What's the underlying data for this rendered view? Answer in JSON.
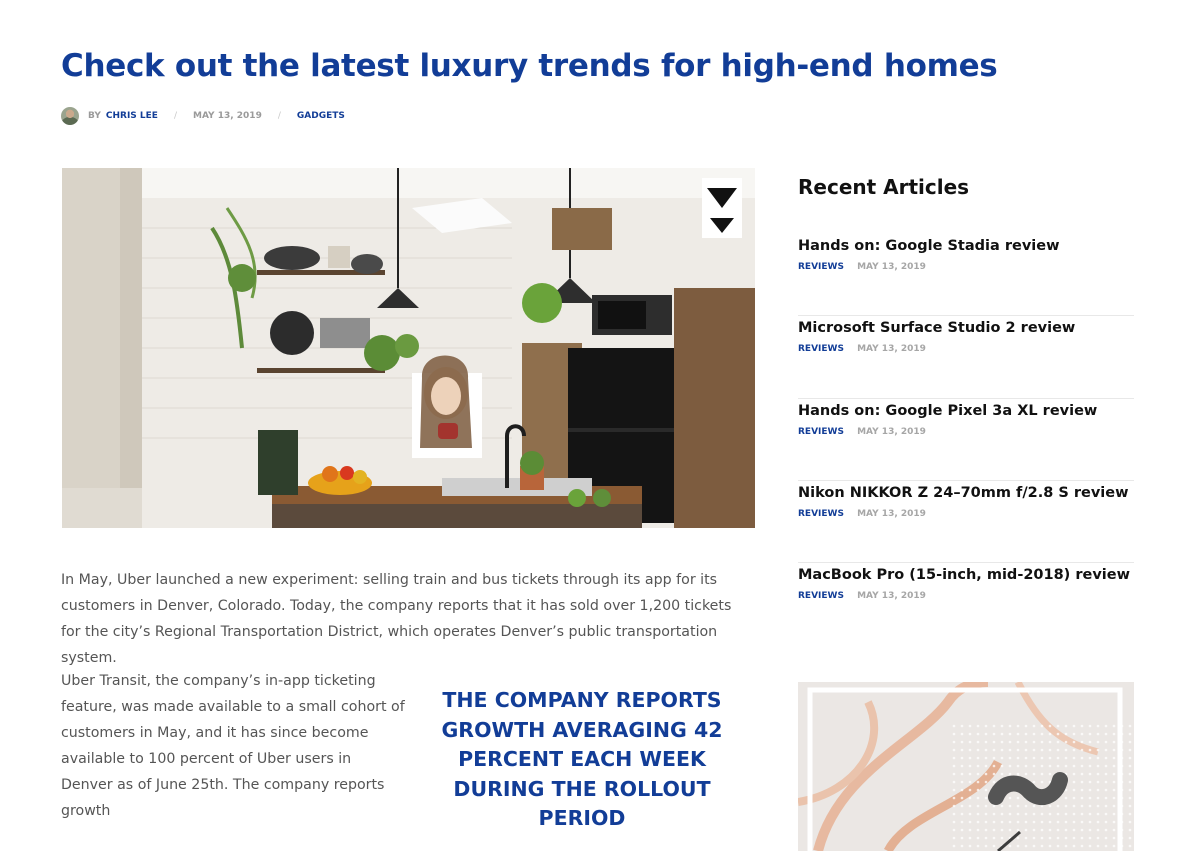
{
  "article": {
    "title": "Check out the latest luxury trends for high-end homes",
    "meta": {
      "by": "BY",
      "author": "CHRIS LEE",
      "date": "MAY 13, 2019",
      "category": "GADGETS",
      "separator": "/"
    },
    "paragraph1": "In May, Uber launched a new experiment: selling train and bus tickets through its app for its customers in Denver, Colorado. Today, the company reports that it has sold over 1,200 tickets for the city’s Regional Transportation District, which operates Denver’s public transportation system.",
    "paragraph2": "Uber Transit, the company’s in-app ticketing feature, was made available to a small cohort of customers in May, and it has since become available to 100 percent of Uber users in Denver as of June 25th. The company reports growth",
    "pullquote": "THE COMPANY REPORTS GROWTH AVERAGING 42 PERCENT EACH WEEK DURING THE ROLLOUT PERIOD"
  },
  "sidebar": {
    "title": "Recent Articles",
    "items": [
      {
        "title": "Hands on: Google Stadia review",
        "category": "REVIEWS",
        "date": "MAY 13, 2019"
      },
      {
        "title": "Microsoft Surface Studio 2 review",
        "category": "REVIEWS",
        "date": "MAY 13, 2019"
      },
      {
        "title": "Hands on: Google Pixel 3a XL review",
        "category": "REVIEWS",
        "date": "MAY 13, 2019"
      },
      {
        "title": "Nikon NIKKOR Z 24–70mm f/2.8 S review",
        "category": "REVIEWS",
        "date": "MAY 13, 2019"
      },
      {
        "title": "MacBook Pro (15-inch, mid-2018) review",
        "category": "REVIEWS",
        "date": "MAY 13, 2019"
      }
    ]
  },
  "colors": {
    "accent": "#123d97",
    "body_text": "#555555",
    "muted": "#9a9a9a"
  }
}
